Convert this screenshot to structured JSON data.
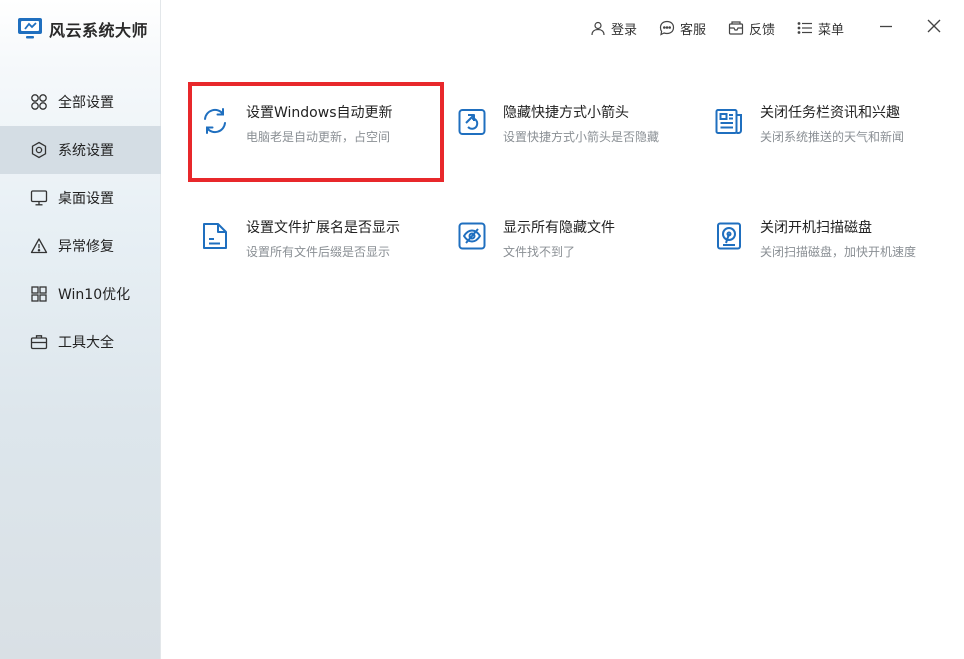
{
  "app": {
    "title": "风云系统大师",
    "brand_icon": "monitor-logo-icon",
    "accent": "#1f6fbf"
  },
  "sidebar": {
    "items": [
      {
        "label": "全部设置",
        "icon": "four-circles-icon",
        "active": false
      },
      {
        "label": "系统设置",
        "icon": "gear-hexagon-icon",
        "active": true
      },
      {
        "label": "桌面设置",
        "icon": "monitor-icon",
        "active": false
      },
      {
        "label": "异常修复",
        "icon": "warning-triangle-icon",
        "active": false
      },
      {
        "label": "Win10优化",
        "icon": "windows-grid-icon",
        "active": false
      },
      {
        "label": "工具大全",
        "icon": "briefcase-icon",
        "active": false
      }
    ]
  },
  "topbar": {
    "login": "登录",
    "service": "客服",
    "feedback": "反馈",
    "menu": "菜单"
  },
  "cards": [
    {
      "title": "设置Windows自动更新",
      "desc": "电脑老是自动更新，占空间",
      "icon": "refresh-icon",
      "highlighted": true
    },
    {
      "title": "隐藏快捷方式小箭头",
      "desc": "设置快捷方式小箭头是否隐藏",
      "icon": "shortcut-arrow-icon",
      "highlighted": false
    },
    {
      "title": "关闭任务栏资讯和兴趣",
      "desc": "关闭系统推送的天气和新闻",
      "icon": "newspaper-icon",
      "highlighted": false
    },
    {
      "title": "设置文件扩展名是否显示",
      "desc": "设置所有文件后缀是否显示",
      "icon": "file-icon",
      "highlighted": false
    },
    {
      "title": "显示所有隐藏文件",
      "desc": "文件找不到了",
      "icon": "hidden-eye-icon",
      "highlighted": false
    },
    {
      "title": "关闭开机扫描磁盘",
      "desc": "关闭扫描磁盘，加快开机速度",
      "icon": "disk-scan-icon",
      "highlighted": false
    }
  ],
  "colors": {
    "icon_blue": "#1f6fbf",
    "highlight_red": "#e8282b",
    "sidebar_active": "#d4dde4"
  }
}
